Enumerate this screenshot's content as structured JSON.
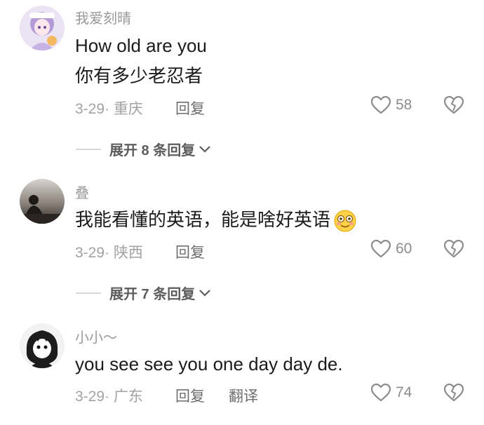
{
  "comments": [
    {
      "username": "我爱刻晴",
      "text_lines": [
        "How old are you",
        "你有多少老忍者"
      ],
      "date": "3-29",
      "location": "重庆",
      "reply_label": "回复",
      "likes": "58",
      "expand_label": "展开 8 条回复"
    },
    {
      "username": "叠",
      "text_lines": [
        "我能看懂的英语，能是啥好英语"
      ],
      "date": "3-29",
      "location": "陕西",
      "reply_label": "回复",
      "likes": "60",
      "expand_label": "展开 7 条回复"
    },
    {
      "username": "小小～",
      "text_lines": [
        "you see see you one day day de."
      ],
      "date": "3-29",
      "location": "广东",
      "reply_label": "回复",
      "translate_label": "翻译",
      "likes": "74"
    }
  ],
  "colors": {
    "username": "#9a9a9a",
    "meta": "#a2a2a2",
    "like_icon": "#8c8c8c",
    "divider": "#d8d8d8"
  },
  "icons": {
    "like": "heart-outline-icon",
    "dislike": "broken-heart-icon",
    "expand": "chevron-down-icon",
    "emoji": "smiling-face-emoji"
  }
}
